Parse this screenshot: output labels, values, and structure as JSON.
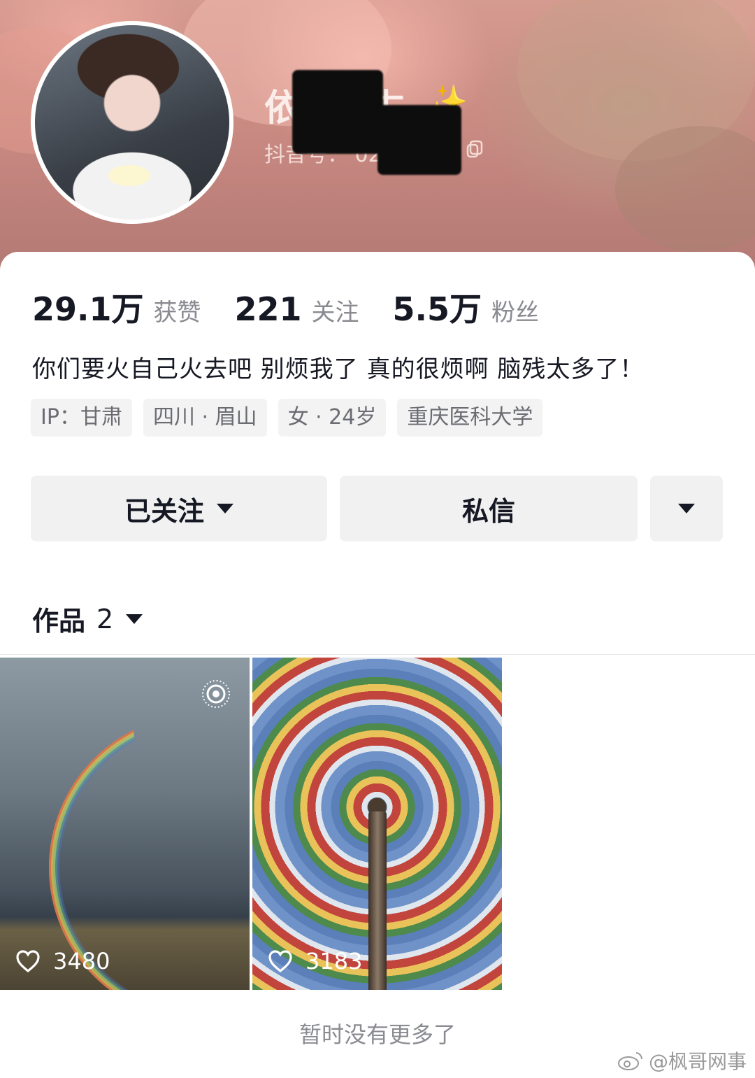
{
  "profile": {
    "nickname": "依 比 古",
    "sparkle": "✨",
    "douyin_id": "抖音号： 02   0",
    "stats": [
      {
        "value": "29.1万",
        "label": "获赞"
      },
      {
        "value": "221",
        "label": "关注"
      },
      {
        "value": "5.5万",
        "label": "粉丝"
      }
    ],
    "bio": "你们要火自己火去吧 别烦我了 真的很烦啊 脑残太多了！",
    "tags": [
      "IP：甘肃",
      "四川 · 眉山",
      "女 · 24岁",
      "重庆医科大学"
    ]
  },
  "actions": {
    "follow_label": "已关注",
    "message_label": "私信"
  },
  "works": {
    "label": "作品",
    "count": "2",
    "items": [
      {
        "likes": "3480",
        "icon": "heart-icon"
      },
      {
        "likes": "3183",
        "icon": "heart-icon"
      }
    ]
  },
  "footer": {
    "no_more": "暂时没有更多了",
    "watermark": "@枫哥网事"
  },
  "colors": {
    "accent_text": "#161823",
    "muted_text": "#8a8b91",
    "button_bg": "#f1f1f2"
  }
}
